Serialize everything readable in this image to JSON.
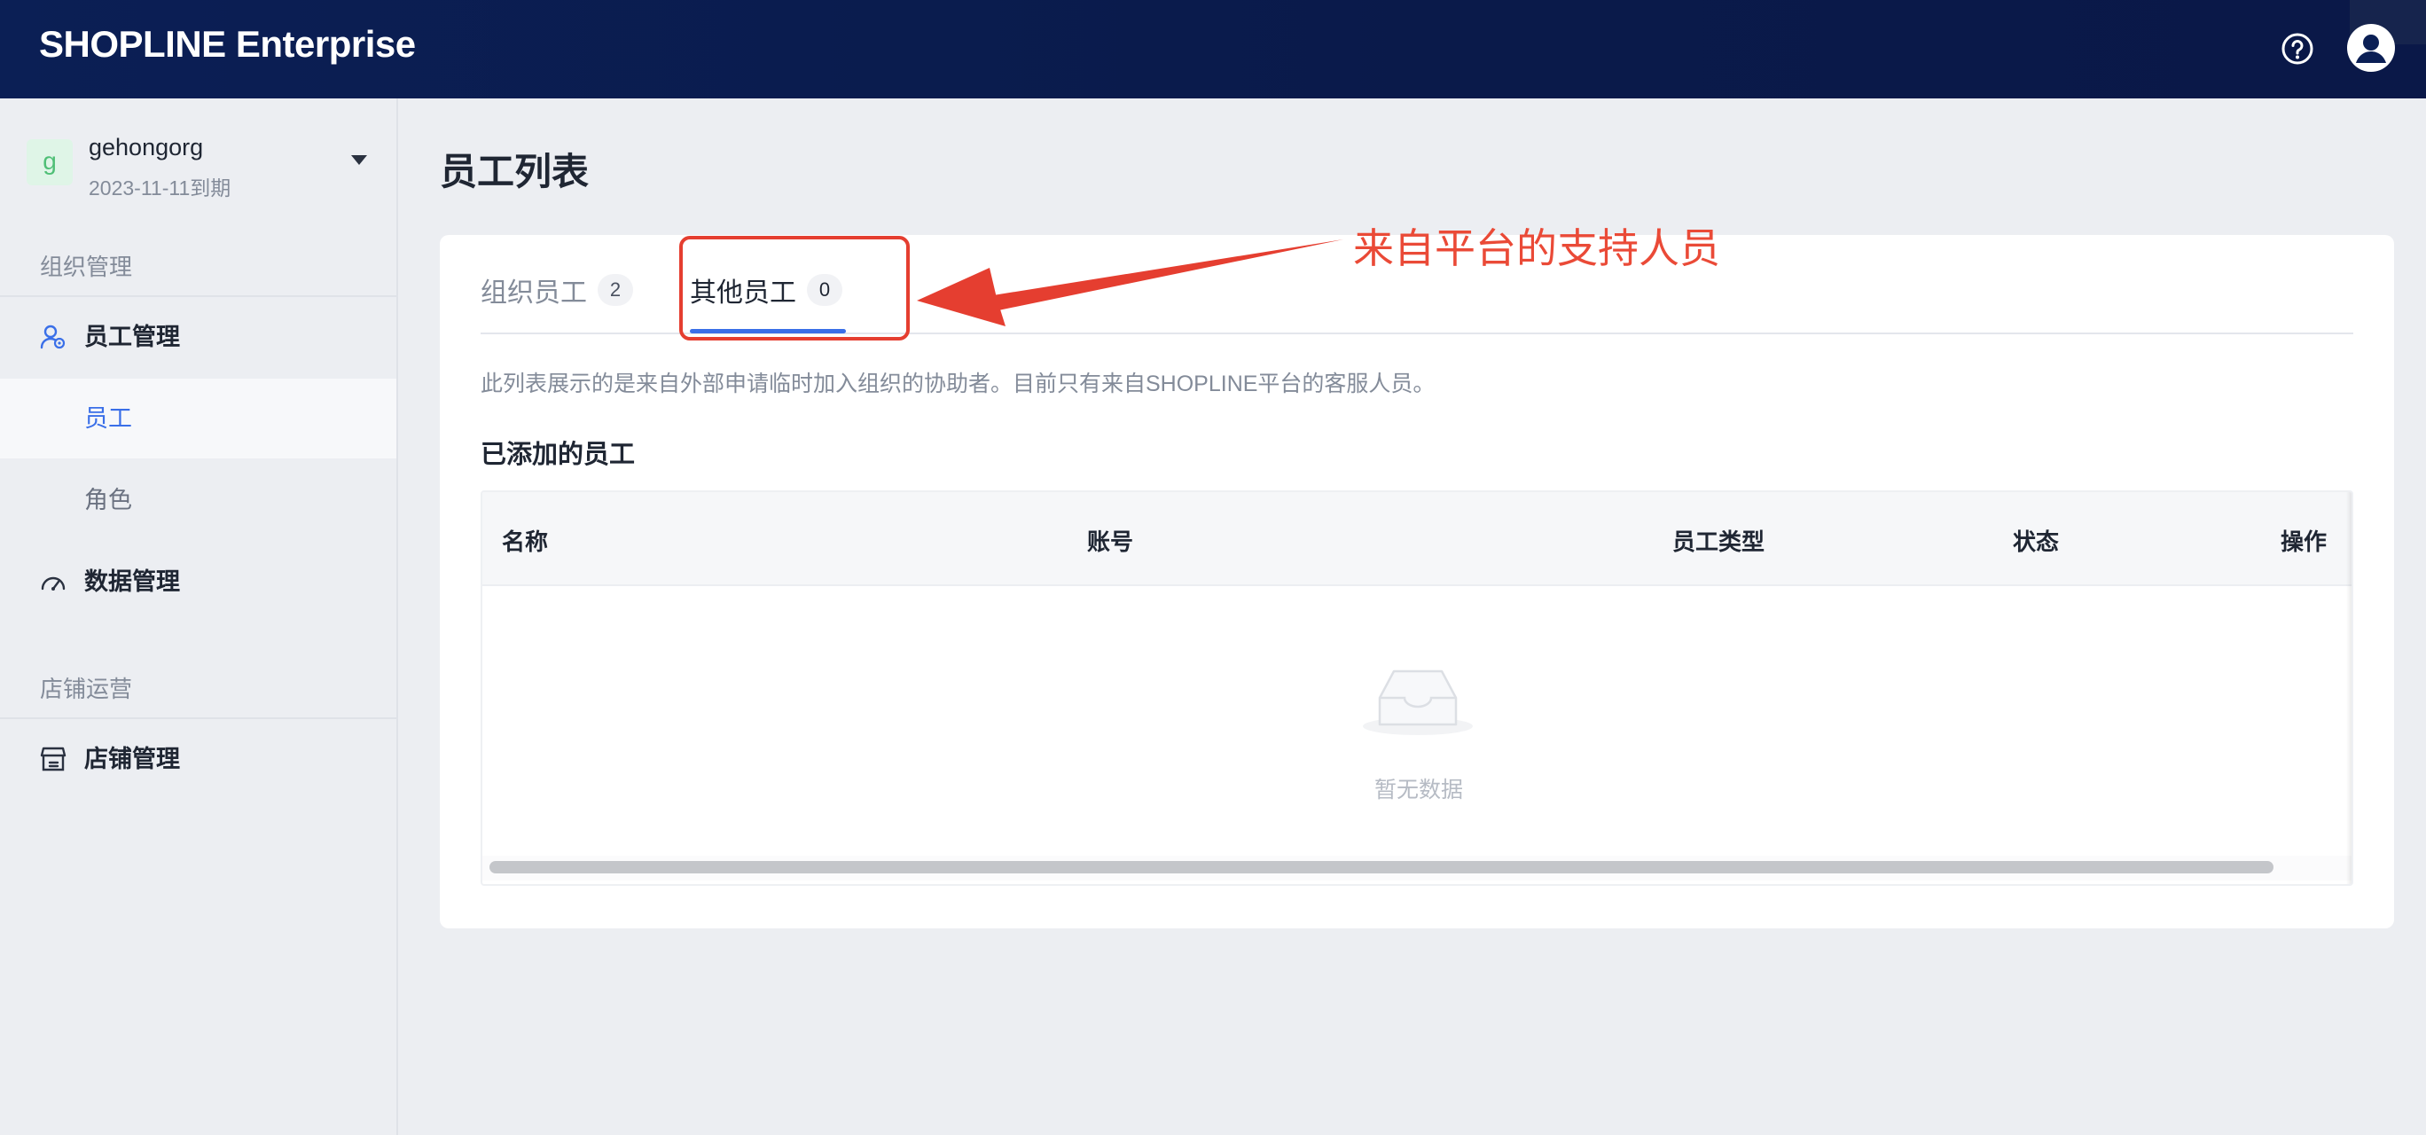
{
  "header": {
    "brand_part1": "SHOPLINE",
    "brand_part2": "Enterprise",
    "help_icon": "help-circle-icon",
    "avatar_icon": "user-avatar-icon"
  },
  "sidebar": {
    "org": {
      "avatar_letter": "g",
      "name": "gehongorg",
      "expire": "2023-11-11到期"
    },
    "sections": [
      {
        "title": "组织管理",
        "items": [
          {
            "label": "员工管理",
            "icon": "user-settings-icon",
            "children": [
              {
                "label": "员工",
                "active": true
              },
              {
                "label": "角色",
                "active": false
              }
            ]
          },
          {
            "label": "数据管理",
            "icon": "gauge-icon"
          }
        ]
      },
      {
        "title": "店铺运营",
        "items": [
          {
            "label": "店铺管理",
            "icon": "store-icon"
          }
        ]
      }
    ]
  },
  "main": {
    "title": "员工列表",
    "tabs": [
      {
        "label": "组织员工",
        "count": "2",
        "active": false
      },
      {
        "label": "其他员工",
        "count": "0",
        "active": true
      }
    ],
    "description": "此列表展示的是来自外部申请临时加入组织的协助者。目前只有来自SHOPLINE平台的客服人员。",
    "subtitle": "已添加的员工",
    "table": {
      "columns": [
        "名称",
        "账号",
        "员工类型",
        "状态",
        "操作"
      ],
      "rows": [],
      "empty_text": "暂无数据",
      "empty_icon": "empty-inbox-icon"
    }
  },
  "annotation": {
    "text": "来自平台的支持人员",
    "color": "#e53e30"
  },
  "colors": {
    "header_bg": "#0b1f55",
    "accent": "#3a6fe8",
    "annotation": "#e53e30"
  }
}
